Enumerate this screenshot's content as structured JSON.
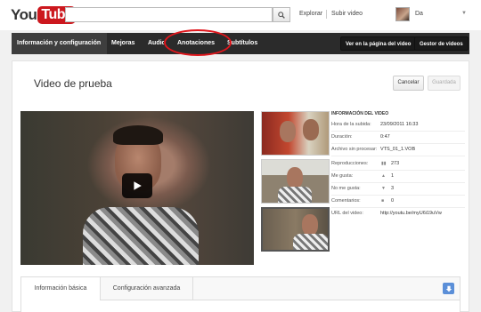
{
  "brand": {
    "you": "You",
    "tube": "Tube"
  },
  "search": {
    "value": "",
    "placeholder": ""
  },
  "top_links": {
    "explore": "Explorar",
    "upload": "Subir video"
  },
  "user": {
    "name": "Da"
  },
  "nav": {
    "tabs": [
      {
        "label": "Información y configuración"
      },
      {
        "label": "Mejoras"
      },
      {
        "label": "Audio"
      },
      {
        "label": "Anotaciones"
      },
      {
        "label": "Subtítulos"
      }
    ],
    "view_button": "Ver en la página del video",
    "manager_button": "Gestor de videos"
  },
  "page": {
    "title": "Video de prueba",
    "cancel": "Cancelar",
    "save": "Guardada"
  },
  "video_info": {
    "header": "INFORMACIÓN DEL VIDEO",
    "upload_time_label": "Hora de la subida:",
    "upload_time": "23/09/2011 16:33",
    "duration_label": "Duración:",
    "duration": "0:47",
    "raw_file_label": "Archivo sin procesar:",
    "raw_file": "VTS_01_1.VOB",
    "views_label": "Reproducciones:",
    "views": "273",
    "likes_label": "Me gusta:",
    "likes": "1",
    "dislikes_label": "No me gusta:",
    "dislikes": "3",
    "comments_label": "Comentarios:",
    "comments": "0",
    "url_label": "URL del video:",
    "url": "http://youtu.be/myU6i19uVw"
  },
  "bottom_tabs": {
    "basic": "Información básica",
    "advanced": "Configuración avanzada"
  },
  "colors": {
    "accent_red": "#cc181e",
    "annotation_ring": "#e0161c",
    "nav_bg": "#2b2b2b"
  }
}
